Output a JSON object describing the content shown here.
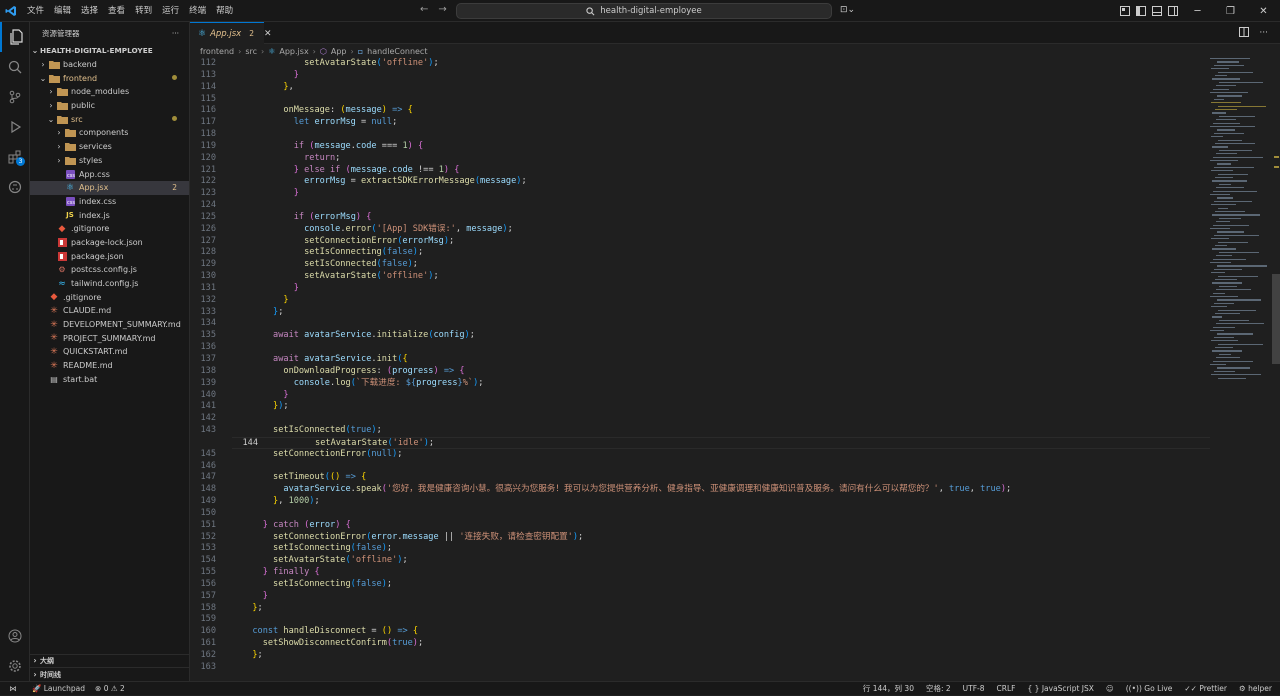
{
  "menu": [
    "文件",
    "编辑",
    "选择",
    "查看",
    "转到",
    "运行",
    "终端",
    "帮助"
  ],
  "search": {
    "text": "health-digital-employee"
  },
  "explorer": {
    "title": "资源管理器",
    "root": "HEALTH-DIGITAL-EMPLOYEE",
    "items": [
      {
        "label": "backend",
        "type": "folder",
        "depth": 1,
        "open": false
      },
      {
        "label": "frontend",
        "type": "folder",
        "depth": 1,
        "open": true,
        "modified": true
      },
      {
        "label": "node_modules",
        "type": "folder",
        "depth": 2,
        "open": false
      },
      {
        "label": "public",
        "type": "folder",
        "depth": 2,
        "open": false
      },
      {
        "label": "src",
        "type": "folder",
        "depth": 2,
        "open": true,
        "modified": true
      },
      {
        "label": "components",
        "type": "folder",
        "depth": 3,
        "open": false
      },
      {
        "label": "services",
        "type": "folder",
        "depth": 3,
        "open": false
      },
      {
        "label": "styles",
        "type": "folder",
        "depth": 3,
        "open": false
      },
      {
        "label": "App.css",
        "type": "css",
        "depth": 3
      },
      {
        "label": "App.jsx",
        "type": "jsx",
        "depth": 3,
        "selected": true,
        "count": "2"
      },
      {
        "label": "index.css",
        "type": "css",
        "depth": 3
      },
      {
        "label": "index.js",
        "type": "js",
        "depth": 3
      },
      {
        "label": ".gitignore",
        "type": "git",
        "depth": 2
      },
      {
        "label": "package-lock.json",
        "type": "npm",
        "depth": 2
      },
      {
        "label": "package.json",
        "type": "npm",
        "depth": 2
      },
      {
        "label": "postcss.config.js",
        "type": "cfg",
        "depth": 2
      },
      {
        "label": "tailwind.config.js",
        "type": "tw",
        "depth": 2
      },
      {
        "label": ".gitignore",
        "type": "git",
        "depth": 1
      },
      {
        "label": "CLAUDE.md",
        "type": "md",
        "depth": 1
      },
      {
        "label": "DEVELOPMENT_SUMMARY.md",
        "type": "md",
        "depth": 1
      },
      {
        "label": "PROJECT_SUMMARY.md",
        "type": "md",
        "depth": 1
      },
      {
        "label": "QUICKSTART.md",
        "type": "md",
        "depth": 1
      },
      {
        "label": "README.md",
        "type": "md",
        "depth": 1
      },
      {
        "label": "start.bat",
        "type": "bat",
        "depth": 1
      }
    ],
    "outline": "大纲",
    "timeline": "时间线"
  },
  "tab": {
    "title": "App.jsx",
    "count": "2"
  },
  "breadcrumb": [
    "frontend",
    "src",
    "App.jsx",
    "App",
    "handleConnect"
  ],
  "lines": [
    {
      "n": "112",
      "h": "            <span class='fn'>setAvatarState</span><span class='br3'>(</span><span class='st'>'offline'</span><span class='br3'>)</span>;"
    },
    {
      "n": "113",
      "h": "          <span class='br2'>}</span>"
    },
    {
      "n": "114",
      "h": "        <span class='br1'>}</span>,"
    },
    {
      "n": "115",
      "h": ""
    },
    {
      "n": "116",
      "h": "        <span class='fn'>onMessage</span>: <span class='br1'>(</span><span class='vr'>message</span><span class='br1'>)</span> <span class='kw'>=&gt;</span> <span class='br1'>{</span>"
    },
    {
      "n": "117",
      "h": "          <span class='kw'>let</span> <span class='vr'>errorMsg</span> = <span class='kw'>null</span>;"
    },
    {
      "n": "118",
      "h": ""
    },
    {
      "n": "119",
      "h": "          <span class='kc'>if</span> <span class='br2'>(</span><span class='vr'>message</span>.<span class='vr'>code</span> === <span class='nm'>1</span><span class='br2'>)</span> <span class='br2'>{</span>"
    },
    {
      "n": "120",
      "h": "            <span class='kc'>return</span>;"
    },
    {
      "n": "121",
      "h": "          <span class='br2'>}</span> <span class='kc'>else if</span> <span class='br2'>(</span><span class='vr'>message</span>.<span class='vr'>code</span> !== <span class='nm'>1</span><span class='br2'>)</span> <span class='br2'>{</span>"
    },
    {
      "n": "122",
      "h": "            <span class='vr'>errorMsg</span> = <span class='fn'>extractSDKErrorMessage</span><span class='br3'>(</span><span class='vr'>message</span><span class='br3'>)</span>;"
    },
    {
      "n": "123",
      "h": "          <span class='br2'>}</span>"
    },
    {
      "n": "124",
      "h": ""
    },
    {
      "n": "125",
      "h": "          <span class='kc'>if</span> <span class='br2'>(</span><span class='vr'>errorMsg</span><span class='br2'>)</span> <span class='br2'>{</span>"
    },
    {
      "n": "126",
      "h": "            <span class='vr'>console</span>.<span class='fn'>error</span><span class='br3'>(</span><span class='st'>'[App] SDK错误:'</span>, <span class='vr'>message</span><span class='br3'>)</span>;"
    },
    {
      "n": "127",
      "h": "            <span class='fn'>setConnectionError</span><span class='br3'>(</span><span class='vr'>errorMsg</span><span class='br3'>)</span>;"
    },
    {
      "n": "128",
      "h": "            <span class='fn'>setIsConnecting</span><span class='br3'>(</span><span class='kw'>false</span><span class='br3'>)</span>;"
    },
    {
      "n": "129",
      "h": "            <span class='fn'>setIsConnected</span><span class='br3'>(</span><span class='kw'>false</span><span class='br3'>)</span>;"
    },
    {
      "n": "130",
      "h": "            <span class='fn'>setAvatarState</span><span class='br3'>(</span><span class='st'>'offline'</span><span class='br3'>)</span>;"
    },
    {
      "n": "131",
      "h": "          <span class='br2'>}</span>"
    },
    {
      "n": "132",
      "h": "        <span class='br1'>}</span>"
    },
    {
      "n": "133",
      "h": "      <span class='br3'>}</span>;"
    },
    {
      "n": "134",
      "h": ""
    },
    {
      "n": "135",
      "h": "      <span class='kc'>await</span> <span class='vr'>avatarService</span>.<span class='fn'>initialize</span><span class='br3'>(</span><span class='vr'>config</span><span class='br3'>)</span>;"
    },
    {
      "n": "136",
      "h": ""
    },
    {
      "n": "137",
      "h": "      <span class='kc'>await</span> <span class='vr'>avatarService</span>.<span class='fn'>init</span><span class='br3'>(</span><span class='br1'>{</span>"
    },
    {
      "n": "138",
      "h": "        <span class='fn'>onDownloadProgress</span>: <span class='br2'>(</span><span class='vr'>progress</span><span class='br2'>)</span> <span class='kw'>=&gt;</span> <span class='br2'>{</span>"
    },
    {
      "n": "139",
      "h": "          <span class='vr'>console</span>.<span class='fn'>log</span><span class='br3'>(</span><span class='st'>`下载进度: </span><span class='kw'>${</span><span class='vr'>progress</span><span class='kw'>}</span><span class='st'>%`</span><span class='br3'>)</span>;"
    },
    {
      "n": "140",
      "h": "        <span class='br2'>}</span>"
    },
    {
      "n": "141",
      "h": "      <span class='br1'>}</span><span class='br3'>)</span>;"
    },
    {
      "n": "142",
      "h": ""
    },
    {
      "n": "143",
      "h": "      <span class='fn'>setIsConnected</span><span class='br3'>(</span><span class='kw'>true</span><span class='br3'>)</span>;"
    },
    {
      "n": "144",
      "h": "      <span class='fn'>setAvatarState</span><span class='br3'>(</span><span class='st'>'idle'</span><span class='br3'>)</span>;",
      "cur": true
    },
    {
      "n": "145",
      "h": "      <span class='fn'>setConnectionError</span><span class='br3'>(</span><span class='kw'>null</span><span class='br3'>)</span>;"
    },
    {
      "n": "146",
      "h": ""
    },
    {
      "n": "147",
      "h": "      <span class='fn'>setTimeout</span><span class='br3'>(</span><span class='br1'>(</span><span class='br1'>)</span> <span class='kw'>=&gt;</span> <span class='br1'>{</span>"
    },
    {
      "n": "148",
      "h": "        <span class='vr'>avatarService</span>.<span class='fn'>speak</span><span class='br2'>(</span><span class='st'>'您好，我是健康咨询小慧。很高兴为您服务！我可以为您提供营养分析、健身指导、亚健康调理和健康知识普及服务。请问有什么可以帮您的？'</span>, <span class='kw'>true</span>, <span class='kw'>true</span><span class='br2'>)</span>;"
    },
    {
      "n": "149",
      "h": "      <span class='br1'>}</span>, <span class='nm'>1000</span><span class='br3'>)</span>;"
    },
    {
      "n": "150",
      "h": ""
    },
    {
      "n": "151",
      "h": "    <span class='br2'>}</span> <span class='kc'>catch</span> <span class='br2'>(</span><span class='vr'>error</span><span class='br2'>)</span> <span class='br2'>{</span>"
    },
    {
      "n": "152",
      "h": "      <span class='fn'>setConnectionError</span><span class='br3'>(</span><span class='vr'>error</span>.<span class='vr'>message</span> || <span class='st'>'连接失败，请检查密钥配置'</span><span class='br3'>)</span>;"
    },
    {
      "n": "153",
      "h": "      <span class='fn'>setIsConnecting</span><span class='br3'>(</span><span class='kw'>false</span><span class='br3'>)</span>;"
    },
    {
      "n": "154",
      "h": "      <span class='fn'>setAvatarState</span><span class='br3'>(</span><span class='st'>'offline'</span><span class='br3'>)</span>;"
    },
    {
      "n": "155",
      "h": "    <span class='br2'>}</span> <span class='kc'>finally</span> <span class='br2'>{</span>"
    },
    {
      "n": "156",
      "h": "      <span class='fn'>setIsConnecting</span><span class='br3'>(</span><span class='kw'>false</span><span class='br3'>)</span>;"
    },
    {
      "n": "157",
      "h": "    <span class='br2'>}</span>"
    },
    {
      "n": "158",
      "h": "  <span class='br1'>}</span>;"
    },
    {
      "n": "159",
      "h": ""
    },
    {
      "n": "160",
      "h": "  <span class='kw'>const</span> <span class='fn'>handleDisconnect</span> = <span class='br1'>(</span><span class='br1'>)</span> <span class='kw'>=&gt;</span> <span class='br1'>{</span>"
    },
    {
      "n": "161",
      "h": "    <span class='fn'>setShowDisconnectConfirm</span><span class='br2'>(</span><span class='kw'>true</span><span class='br2'>)</span>;"
    },
    {
      "n": "162",
      "h": "  <span class='br1'>}</span>;"
    },
    {
      "n": "163",
      "h": ""
    }
  ],
  "status": {
    "launchpad": "Launchpad",
    "errors": "0",
    "warnings": "2",
    "position": "行 144，列 30",
    "spaces": "空格: 2",
    "encoding": "UTF-8",
    "eol": "CRLF",
    "language": "JavaScript JSX",
    "golive": "Go Live",
    "prettier": "Prettier",
    "helper": "helper"
  }
}
